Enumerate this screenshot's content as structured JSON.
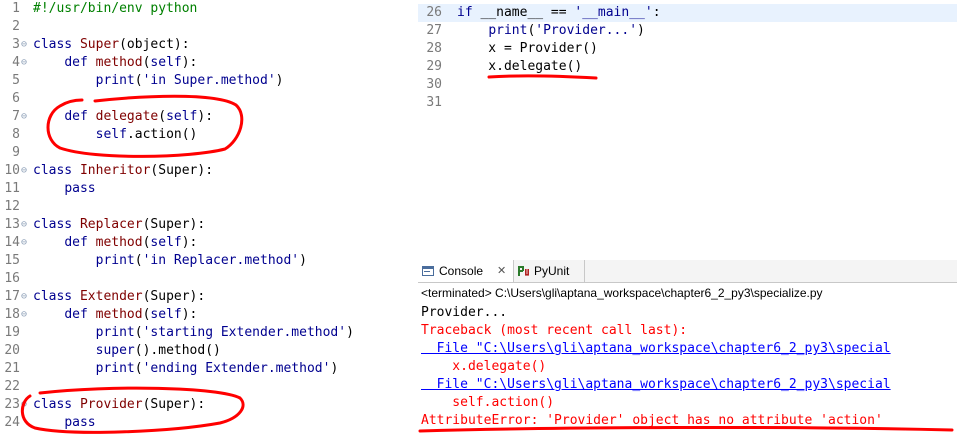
{
  "left_editor": {
    "lines": [
      {
        "n": "1",
        "fold": "",
        "tokens": [
          [
            "cm",
            "#!/usr/bin/env python"
          ]
        ]
      },
      {
        "n": "2",
        "fold": "",
        "tokens": []
      },
      {
        "n": "3",
        "fold": "⊖",
        "tokens": [
          [
            "kw",
            "class "
          ],
          [
            "cls",
            "Super"
          ],
          [
            "plain",
            "(object):"
          ]
        ]
      },
      {
        "n": "4",
        "fold": "⊖",
        "tokens": [
          [
            "plain",
            "    "
          ],
          [
            "kw",
            "def "
          ],
          [
            "fn",
            "method"
          ],
          [
            "plain",
            "("
          ],
          [
            "kw",
            "self"
          ],
          [
            "plain",
            "):"
          ]
        ]
      },
      {
        "n": "5",
        "fold": "",
        "tokens": [
          [
            "plain",
            "        "
          ],
          [
            "kw",
            "print"
          ],
          [
            "plain",
            "("
          ],
          [
            "str",
            "'in Super.method'"
          ],
          [
            "plain",
            ")"
          ]
        ]
      },
      {
        "n": "6",
        "fold": "",
        "tokens": []
      },
      {
        "n": "7",
        "fold": "⊖",
        "tokens": [
          [
            "plain",
            "    "
          ],
          [
            "kw",
            "def "
          ],
          [
            "fn",
            "delegate"
          ],
          [
            "plain",
            "("
          ],
          [
            "kw",
            "self"
          ],
          [
            "plain",
            "):"
          ]
        ]
      },
      {
        "n": "8",
        "fold": "",
        "tokens": [
          [
            "plain",
            "        "
          ],
          [
            "kw",
            "self"
          ],
          [
            "plain",
            ".action()"
          ]
        ]
      },
      {
        "n": "9",
        "fold": "",
        "tokens": []
      },
      {
        "n": "10",
        "fold": "⊖",
        "tokens": [
          [
            "kw",
            "class "
          ],
          [
            "cls",
            "Inheritor"
          ],
          [
            "plain",
            "(Super):"
          ]
        ]
      },
      {
        "n": "11",
        "fold": "",
        "tokens": [
          [
            "plain",
            "    "
          ],
          [
            "kw",
            "pass"
          ]
        ]
      },
      {
        "n": "12",
        "fold": "",
        "tokens": []
      },
      {
        "n": "13",
        "fold": "⊖",
        "tokens": [
          [
            "kw",
            "class "
          ],
          [
            "cls",
            "Replacer"
          ],
          [
            "plain",
            "(Super):"
          ]
        ]
      },
      {
        "n": "14",
        "fold": "⊖",
        "tokens": [
          [
            "plain",
            "    "
          ],
          [
            "kw",
            "def "
          ],
          [
            "fn",
            "method"
          ],
          [
            "plain",
            "("
          ],
          [
            "kw",
            "self"
          ],
          [
            "plain",
            "):"
          ]
        ]
      },
      {
        "n": "15",
        "fold": "",
        "tokens": [
          [
            "plain",
            "        "
          ],
          [
            "kw",
            "print"
          ],
          [
            "plain",
            "("
          ],
          [
            "str",
            "'in Replacer.method'"
          ],
          [
            "plain",
            ")"
          ]
        ]
      },
      {
        "n": "16",
        "fold": "",
        "tokens": []
      },
      {
        "n": "17",
        "fold": "⊖",
        "tokens": [
          [
            "kw",
            "class "
          ],
          [
            "cls",
            "Extender"
          ],
          [
            "plain",
            "(Super):"
          ]
        ]
      },
      {
        "n": "18",
        "fold": "⊖",
        "tokens": [
          [
            "plain",
            "    "
          ],
          [
            "kw",
            "def "
          ],
          [
            "fn",
            "method"
          ],
          [
            "plain",
            "("
          ],
          [
            "kw",
            "self"
          ],
          [
            "plain",
            "):"
          ]
        ]
      },
      {
        "n": "19",
        "fold": "",
        "tokens": [
          [
            "plain",
            "        "
          ],
          [
            "kw",
            "print"
          ],
          [
            "plain",
            "("
          ],
          [
            "str",
            "'starting Extender.method'"
          ],
          [
            "plain",
            ")"
          ]
        ]
      },
      {
        "n": "20",
        "fold": "",
        "tokens": [
          [
            "plain",
            "        "
          ],
          [
            "kw",
            "super"
          ],
          [
            "plain",
            "().method()"
          ]
        ]
      },
      {
        "n": "21",
        "fold": "",
        "tokens": [
          [
            "plain",
            "        "
          ],
          [
            "kw",
            "print"
          ],
          [
            "plain",
            "("
          ],
          [
            "str",
            "'ending Extender.method'"
          ],
          [
            "plain",
            ")"
          ]
        ]
      },
      {
        "n": "22",
        "fold": "",
        "tokens": []
      },
      {
        "n": "23",
        "fold": "⊖",
        "tokens": [
          [
            "kw",
            "class "
          ],
          [
            "cls",
            "Provider"
          ],
          [
            "plain",
            "(Super):"
          ]
        ]
      },
      {
        "n": "24",
        "fold": "",
        "tokens": [
          [
            "plain",
            "    "
          ],
          [
            "kw",
            "pass"
          ]
        ]
      }
    ]
  },
  "right_editor": {
    "current_line": "26",
    "lines": [
      {
        "n": "26",
        "tokens": [
          [
            "kw",
            "if "
          ],
          [
            "plain",
            "__name__ == "
          ],
          [
            "str",
            "'__main__'"
          ],
          [
            "plain",
            ":"
          ]
        ]
      },
      {
        "n": "27",
        "tokens": [
          [
            "plain",
            "    "
          ],
          [
            "kw",
            "print"
          ],
          [
            "plain",
            "("
          ],
          [
            "str",
            "'Provider...'"
          ],
          [
            "plain",
            ")"
          ]
        ]
      },
      {
        "n": "28",
        "tokens": [
          [
            "plain",
            "    x = Provider()"
          ]
        ]
      },
      {
        "n": "29",
        "tokens": [
          [
            "plain",
            "    x.delegate()"
          ]
        ]
      },
      {
        "n": "30",
        "tokens": []
      },
      {
        "n": "31",
        "tokens": []
      }
    ]
  },
  "console": {
    "tabs": {
      "console": {
        "label": "Console",
        "close": "✕",
        "icon": "console-icon"
      },
      "pyunit": {
        "label": "PyUnit",
        "icon": "pyunit-icon"
      }
    },
    "status": "<terminated> C:\\Users\\gli\\aptana_workspace\\chapter6_2_py3\\specialize.py",
    "output": [
      {
        "style": "normal",
        "text": "Provider..."
      },
      {
        "style": "err",
        "text": "Traceback (most recent call last):"
      },
      {
        "style": "link",
        "text": "  File \"C:\\Users\\gli\\aptana_workspace\\chapter6_2_py3\\special"
      },
      {
        "style": "err",
        "text": "    x.delegate()"
      },
      {
        "style": "link",
        "text": "  File \"C:\\Users\\gli\\aptana_workspace\\chapter6_2_py3\\special"
      },
      {
        "style": "err",
        "text": "    self.action()"
      },
      {
        "style": "err",
        "text": "AttributeError: 'Provider' object has no attribute 'action'"
      }
    ]
  },
  "colors": {
    "keyword": "#00008f",
    "class_name": "#7f0000",
    "string": "#00008f",
    "comment": "#008000",
    "error": "#ff0000",
    "link": "#0000ff",
    "annotation": "#ff0000"
  }
}
